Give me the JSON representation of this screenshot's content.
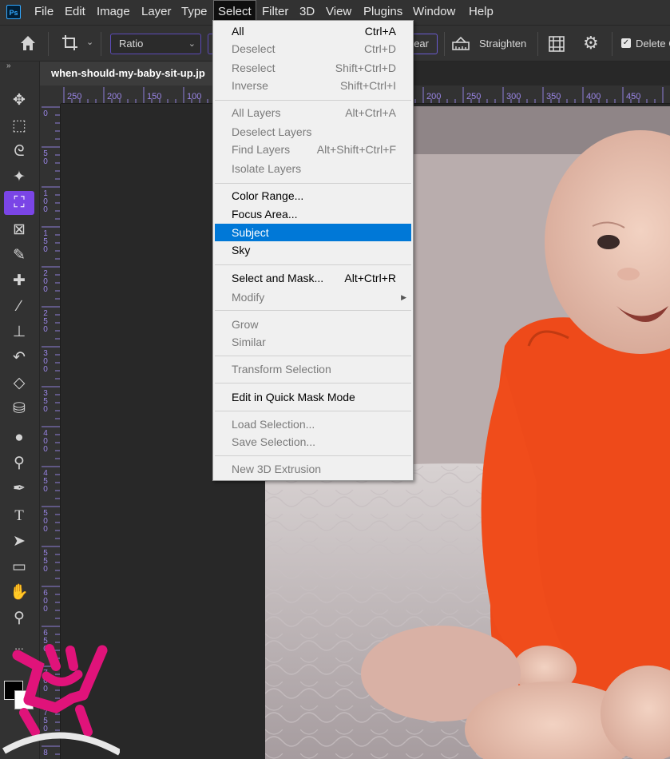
{
  "app": {
    "logo": "Ps"
  },
  "menubar": {
    "items": [
      "File",
      "Edit",
      "Image",
      "Layer",
      "Type",
      "Select",
      "Filter",
      "3D",
      "View",
      "Plugins",
      "Window",
      "Help"
    ],
    "active": "Select"
  },
  "options": {
    "ratio_label": "Ratio",
    "clear_label": "ear",
    "straighten_label": "Straighten",
    "delete_label": "Delete C",
    "delete_checked": true
  },
  "document": {
    "tab_title": "when-should-my-baby-sit-up.jp"
  },
  "rulers": {
    "top_labels": [
      "250",
      "200",
      "150",
      "100",
      "200",
      "250",
      "300",
      "350",
      "400",
      "450"
    ],
    "left_labels": [
      "0",
      "50",
      "100",
      "150",
      "200",
      "250",
      "300",
      "350",
      "400",
      "450",
      "500",
      "550",
      "600",
      "650",
      "700",
      "750",
      "8"
    ]
  },
  "select_menu": {
    "groups": [
      [
        {
          "label": "All",
          "shortcut": "Ctrl+A",
          "enabled": true
        },
        {
          "label": "Deselect",
          "shortcut": "Ctrl+D",
          "enabled": false
        },
        {
          "label": "Reselect",
          "shortcut": "Shift+Ctrl+D",
          "enabled": false
        },
        {
          "label": "Inverse",
          "shortcut": "Shift+Ctrl+I",
          "enabled": false
        }
      ],
      [
        {
          "label": "All Layers",
          "shortcut": "Alt+Ctrl+A",
          "enabled": false
        },
        {
          "label": "Deselect Layers",
          "shortcut": "",
          "enabled": false
        },
        {
          "label": "Find Layers",
          "shortcut": "Alt+Shift+Ctrl+F",
          "enabled": false
        },
        {
          "label": "Isolate Layers",
          "shortcut": "",
          "enabled": false
        }
      ],
      [
        {
          "label": "Color Range...",
          "shortcut": "",
          "enabled": true
        },
        {
          "label": "Focus Area...",
          "shortcut": "",
          "enabled": true
        },
        {
          "label": "Subject",
          "shortcut": "",
          "enabled": true,
          "highlighted": true
        },
        {
          "label": "Sky",
          "shortcut": "",
          "enabled": true
        }
      ],
      [
        {
          "label": "Select and Mask...",
          "shortcut": "Alt+Ctrl+R",
          "enabled": true
        },
        {
          "label": "Modify",
          "shortcut": "",
          "enabled": false,
          "submenu": true
        }
      ],
      [
        {
          "label": "Grow",
          "shortcut": "",
          "enabled": false
        },
        {
          "label": "Similar",
          "shortcut": "",
          "enabled": false
        }
      ],
      [
        {
          "label": "Transform Selection",
          "shortcut": "",
          "enabled": false
        }
      ],
      [
        {
          "label": "Edit in Quick Mask Mode",
          "shortcut": "",
          "enabled": true
        }
      ],
      [
        {
          "label": "Load Selection...",
          "shortcut": "",
          "enabled": false
        },
        {
          "label": "Save Selection...",
          "shortcut": "",
          "enabled": false
        }
      ],
      [
        {
          "label": "New 3D Extrusion",
          "shortcut": "",
          "enabled": false
        }
      ]
    ]
  },
  "toolbar": {
    "tools": [
      {
        "name": "move-tool-icon",
        "glyph": "✥"
      },
      {
        "name": "marquee-tool-icon",
        "glyph": "⬚"
      },
      {
        "name": "lasso-tool-icon",
        "glyph": "ᘓ"
      },
      {
        "name": "magic-wand-tool-icon",
        "glyph": "✨"
      },
      {
        "name": "crop-tool-icon",
        "glyph": "⛶",
        "active": true
      },
      {
        "name": "frame-tool-icon",
        "glyph": "⊠"
      },
      {
        "name": "eyedropper-tool-icon",
        "glyph": "✎"
      },
      {
        "name": "healing-brush-tool-icon",
        "glyph": "✚"
      },
      {
        "name": "brush-tool-icon",
        "glyph": "🖌"
      },
      {
        "name": "stamp-tool-icon",
        "glyph": "⊥"
      },
      {
        "name": "history-brush-tool-icon",
        "glyph": "↶"
      },
      {
        "name": "eraser-tool-icon",
        "glyph": "◇"
      },
      {
        "name": "paint-bucket-tool-icon",
        "glyph": "⛁"
      },
      {
        "name": "blur-tool-icon",
        "glyph": "💧"
      },
      {
        "name": "dodge-tool-icon",
        "glyph": "⚲"
      },
      {
        "name": "pen-tool-icon",
        "glyph": "✒"
      },
      {
        "name": "type-tool-icon",
        "glyph": "T"
      },
      {
        "name": "path-selection-tool-icon",
        "glyph": "➤"
      },
      {
        "name": "rectangle-tool-icon",
        "glyph": "▭"
      },
      {
        "name": "hand-tool-icon",
        "glyph": "✋"
      },
      {
        "name": "zoom-tool-icon",
        "glyph": "🔍"
      }
    ],
    "more": "...",
    "foreground_color": "#000000",
    "background_color": "#ffffff"
  },
  "colors": {
    "accent": "#7a45e6",
    "menu_highlight": "#0078d7",
    "watermark": "#e0137a"
  }
}
